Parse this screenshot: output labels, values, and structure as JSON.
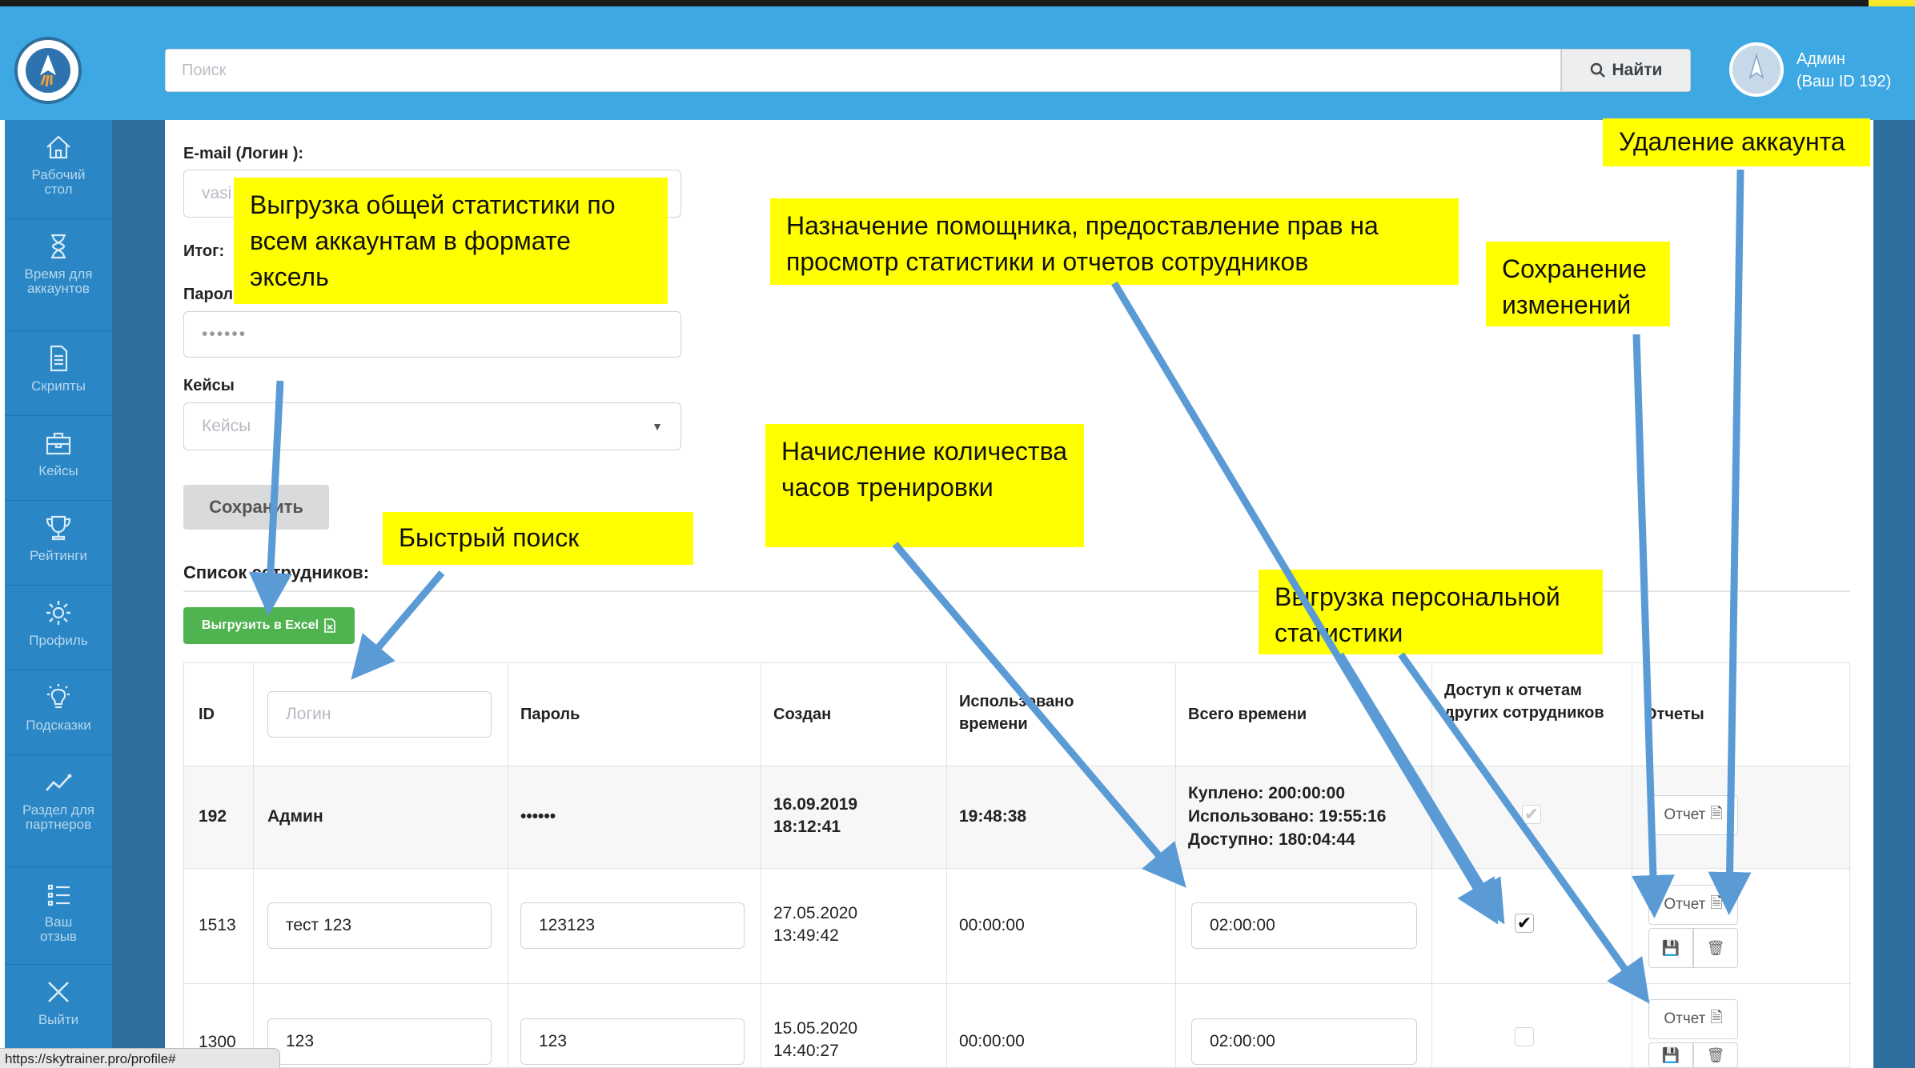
{
  "header": {
    "search_placeholder": "Поиск",
    "search_button": "Найти",
    "user_name": "Админ",
    "user_id": "(Ваш ID 192)"
  },
  "sidebar": {
    "items": [
      {
        "label": "Рабочий стол",
        "icon": "home-icon"
      },
      {
        "label": "Время для аккаунтов",
        "icon": "hourglass-icon"
      },
      {
        "label": "Скрипты",
        "icon": "document-icon"
      },
      {
        "label": "Кейсы",
        "icon": "briefcase-icon"
      },
      {
        "label": "Рейтинги",
        "icon": "trophy-icon"
      },
      {
        "label": "Профиль",
        "icon": "gear-icon"
      },
      {
        "label": "Подсказки",
        "icon": "lightbulb-icon"
      },
      {
        "label": "Раздел для партнеров",
        "icon": "chart-line-icon"
      },
      {
        "label": "Ваш отзыв",
        "icon": "list-icon"
      },
      {
        "label": "Выйти",
        "icon": "close-icon"
      }
    ]
  },
  "form": {
    "email_label": "E-mail (Логин ):",
    "email_placeholder": "vasi",
    "total_label": "Итог:",
    "password_label": "Парол",
    "password_value": "••••••",
    "cases_label": "Кейсы",
    "cases_placeholder": "Кейсы",
    "save_button": "Сохранить"
  },
  "list": {
    "title": "Список сотрудников:",
    "export_button": "Выгрузить в Excel"
  },
  "table": {
    "headers": {
      "id": "ID",
      "login_placeholder": "Логин",
      "password": "Пароль",
      "created": "Создан",
      "used": "Использовано времени",
      "total": "Всего времени",
      "access": "Доступ к отчетам других сотрудников",
      "reports": "Отчеты"
    },
    "rows": [
      {
        "id": "192",
        "login": "Админ",
        "password": "••••••",
        "created_date": "16.09.2019",
        "created_time": "18:12:41",
        "used": "19:48:38",
        "total_bought": "Куплено: 200:00:00",
        "total_used": "Использовано: 19:55:16",
        "total_available": "Доступно: 180:04:44",
        "access": true,
        "report_button": "Отчет"
      },
      {
        "id": "1513",
        "login": "тест 123",
        "password": "123123",
        "created_date": "27.05.2020",
        "created_time": "13:49:42",
        "used": "00:00:00",
        "total": "02:00:00",
        "access": true,
        "report_button": "Отчет"
      },
      {
        "id": "1300",
        "login": "123",
        "password": "123",
        "created_date": "15.05.2020",
        "created_time": "14:40:27",
        "used": "00:00:00",
        "total": "02:00:00",
        "access": false,
        "report_button": "Отчет"
      }
    ]
  },
  "annotations": {
    "excel_export": "Выгрузка общей статистики по всем аккаунтам в формате эксель",
    "assistant": "Назначение помощника, предоставление прав на просмотр статистики и отчетов сотрудников",
    "delete_account": "Удаление аккаунта",
    "save_changes": "Сохранение изменений",
    "training_hours": "Начисление количества часов тренировки",
    "quick_search": "Быстрый поиск",
    "personal_stats": "Выгрузка персональной статистики"
  },
  "status_url": "https://skytrainer.pro/profile#",
  "colors": {
    "topbar": "#3ea8e2",
    "sidebar": "#2a86c4",
    "callout": "#ffff00",
    "arrow": "#5a9bd5",
    "excel_button": "#4fb350"
  }
}
